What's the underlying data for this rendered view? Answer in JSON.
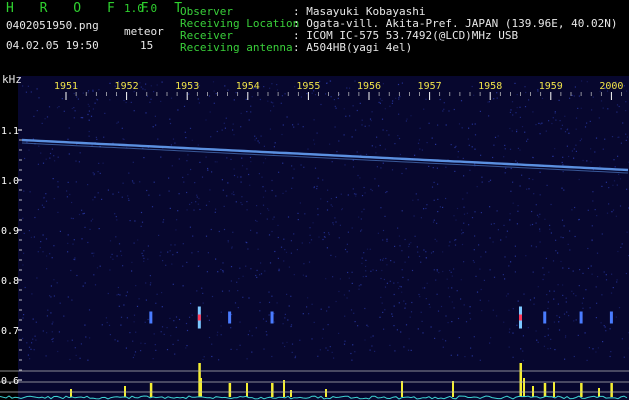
{
  "app": {
    "name": "H R O F F T",
    "version": "1.0.0"
  },
  "file": {
    "name": "0402051950.png",
    "datetime": "04.02.05 19:50"
  },
  "meteor": {
    "label": "meteor",
    "count": "15"
  },
  "info": [
    {
      "key": "Observer",
      "value": ": Masayuki Kobayashi"
    },
    {
      "key": "Receiving Location",
      "value": ": Ogata-vill. Akita-Pref. JAPAN (139.96E, 40.02N)"
    },
    {
      "key": "Receiver",
      "value": ": ICOM IC-575 53.7492(@LCD)MHz USB"
    },
    {
      "key": "Receiving antenna",
      "value": ": A504HB(yagi 4el)"
    }
  ],
  "axis": {
    "unit": "kHz",
    "y_ticks": [
      {
        "label": "1.1",
        "value": 1.1
      },
      {
        "label": "1.0",
        "value": 1.0
      },
      {
        "label": "0.9",
        "value": 0.9
      },
      {
        "label": "0.8",
        "value": 0.8
      },
      {
        "label": "0.7",
        "value": 0.7
      },
      {
        "label": "0.6",
        "value": 0.6
      }
    ],
    "time_ticks": [
      "1951",
      "1952",
      "1953",
      "1954",
      "1955",
      "1956",
      "1957",
      "1958",
      "1959",
      "2000"
    ]
  },
  "colors": {
    "background": "#000000",
    "plot_bg": "#0a0a3a",
    "noise": "#2a3aa8",
    "carrier": "#6aa8ff",
    "header_text": "#39d03a",
    "tick_text": "#f0e34a",
    "detector_spikes": "#f5ef33",
    "baseline": "#3fd3d3"
  },
  "meteor_echoes": [
    {
      "minute_offset": 1.9,
      "strength": "weak"
    },
    {
      "minute_offset": 2.7,
      "strength": "strong"
    },
    {
      "minute_offset": 3.2,
      "strength": "weak"
    },
    {
      "minute_offset": 3.9,
      "strength": "weak"
    },
    {
      "minute_offset": 8.0,
      "strength": "strong"
    },
    {
      "minute_offset": 8.4,
      "strength": "weak"
    },
    {
      "minute_offset": 9.0,
      "strength": "weak"
    },
    {
      "minute_offset": 9.5,
      "strength": "weak"
    }
  ]
}
